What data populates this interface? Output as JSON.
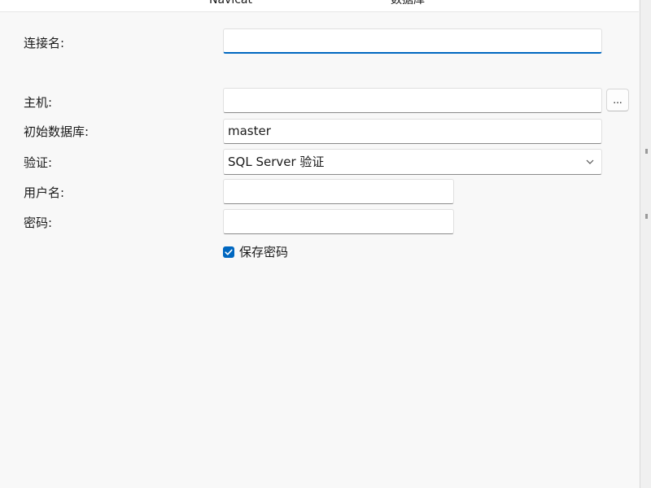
{
  "tabs": {
    "navicat": "Navicat",
    "database": "数据库"
  },
  "form": {
    "connection_name": {
      "label": "连接名:",
      "value": ""
    },
    "host": {
      "label": "主机:",
      "value": "",
      "browse_label": "..."
    },
    "initial_database": {
      "label": "初始数据库:",
      "value": "master"
    },
    "authentication": {
      "label": "验证:",
      "selected": "SQL Server 验证"
    },
    "username": {
      "label": "用户名:",
      "value": ""
    },
    "password": {
      "label": "密码:",
      "value": ""
    },
    "save_password": {
      "label": "保存密码",
      "checked": true
    }
  },
  "colors": {
    "accent": "#0067c0",
    "background": "#f8f8f8",
    "input_background": "#ffffff"
  },
  "icons": {
    "dropdown": "chevron-down-icon",
    "checkbox": "checkmark-icon"
  }
}
